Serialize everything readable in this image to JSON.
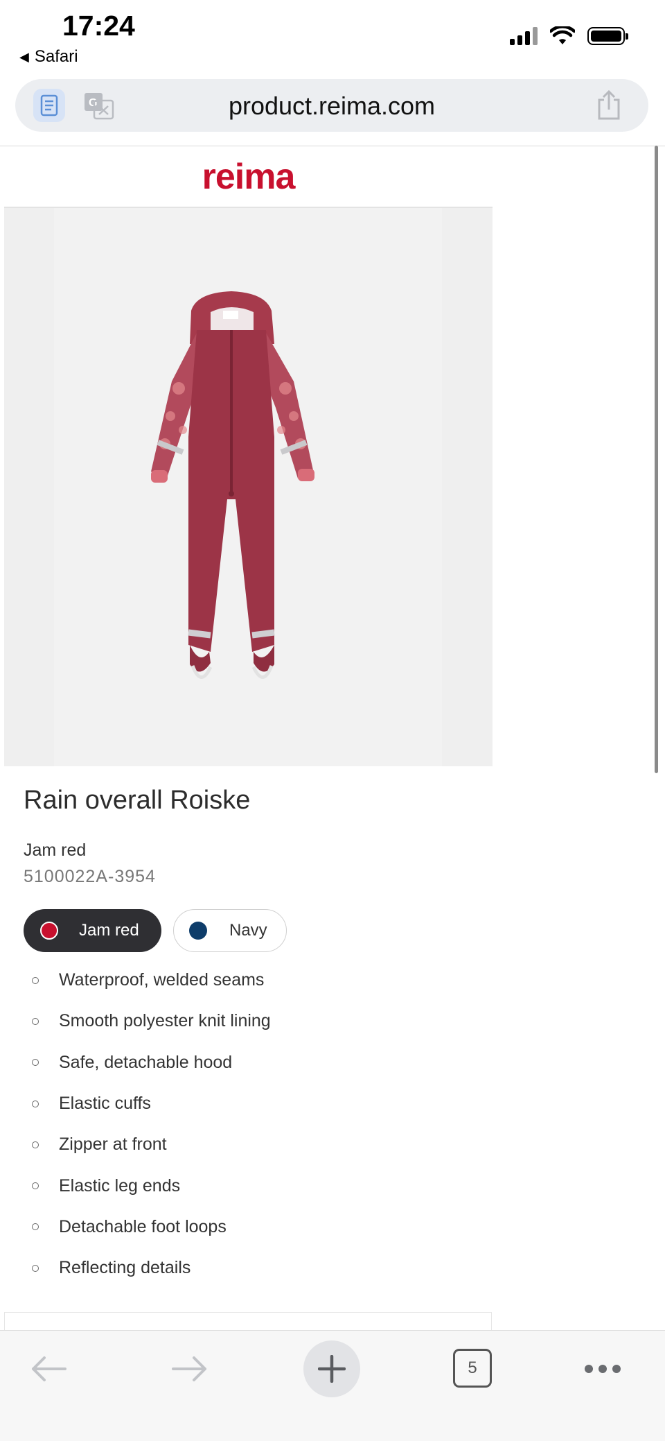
{
  "status_bar": {
    "time": "17:24",
    "back_app": "Safari"
  },
  "browser": {
    "url": "product.reima.com"
  },
  "site": {
    "logo": "reima"
  },
  "product": {
    "title": "Rain overall Roiske",
    "color_name": "Jam red",
    "sku": "5100022A-3954",
    "swatches": [
      {
        "label": "Jam red",
        "color": "#c8102e",
        "selected": true
      },
      {
        "label": "Navy",
        "color": "#0e3d6a",
        "selected": false
      }
    ],
    "features": [
      "Waterproof, welded seams",
      "Smooth polyester knit lining",
      "Safe, detachable hood",
      "Elastic cuffs",
      "Zipper at front",
      "Elastic leg ends",
      "Detachable foot loops",
      "Reflecting details"
    ]
  },
  "toolbar": {
    "tabs_count": "5"
  },
  "colors": {
    "brand": "#c8102e",
    "garment": "#9c3447"
  }
}
